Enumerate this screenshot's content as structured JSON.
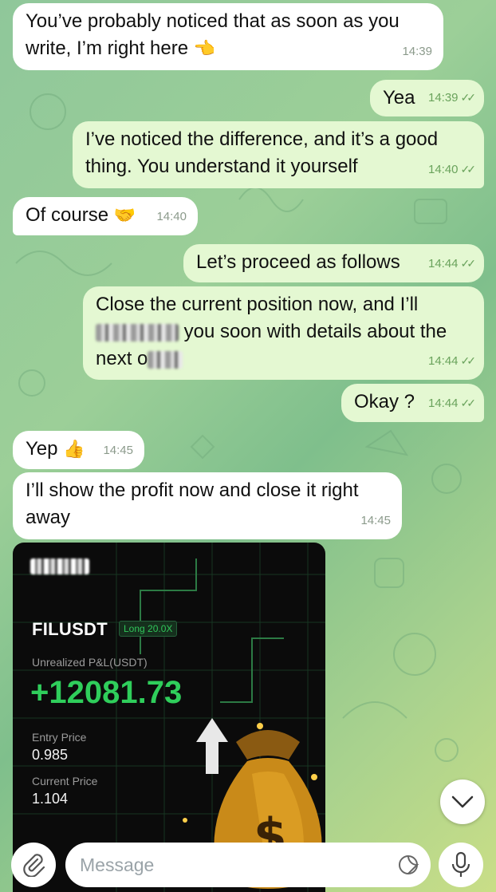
{
  "messages": [
    {
      "id": "m1",
      "dir": "in",
      "lines": [
        "You’ve probably noticed that as soon as you",
        "write, I’m right here"
      ],
      "emoji": "👈",
      "time": "14:39"
    },
    {
      "id": "m2",
      "dir": "out",
      "text": "Yea",
      "time": "14:39"
    },
    {
      "id": "m3",
      "dir": "out",
      "lines": [
        "I’ve noticed the difference, and it’s a good",
        "thing. You understand it yourself"
      ],
      "time": "14:40"
    },
    {
      "id": "m4",
      "dir": "in",
      "text": "Of course",
      "emoji": "🤝",
      "time": "14:40"
    },
    {
      "id": "m5",
      "dir": "out",
      "text": "Let’s proceed as follows",
      "time": "14:44"
    },
    {
      "id": "m6",
      "dir": "out",
      "line1": "Close the current position now, and I’ll",
      "line2_after_blur": "you soon with details about the",
      "line3_prefix": "next o",
      "time": "14:44"
    },
    {
      "id": "m7",
      "dir": "out",
      "text": "Okay ?",
      "time": "14:44"
    },
    {
      "id": "m8",
      "dir": "in",
      "text": "Yep",
      "emoji": "👍",
      "time": "14:45"
    },
    {
      "id": "m9",
      "dir": "in",
      "lines": [
        "I’ll show the profit now and close it right",
        "away"
      ],
      "time": "14:45"
    }
  ],
  "ticks": "✓✓",
  "card": {
    "pair": "FILUSDT",
    "leverage": "Long 20.0X",
    "pnl_label": "Unrealized P&L(USDT)",
    "pnl_value": "+12081.73",
    "entry_label": "Entry Price",
    "entry_value": "0.985",
    "current_label": "Current Price",
    "current_value": "1.104",
    "colors": {
      "profit": "#2fce5b",
      "bg": "#0b0b0b"
    }
  },
  "composer": {
    "placeholder": "Message"
  },
  "icons": [
    "attach-icon",
    "sticker-icon",
    "mic-icon",
    "chevron-down-icon",
    "double-check-icon"
  ]
}
